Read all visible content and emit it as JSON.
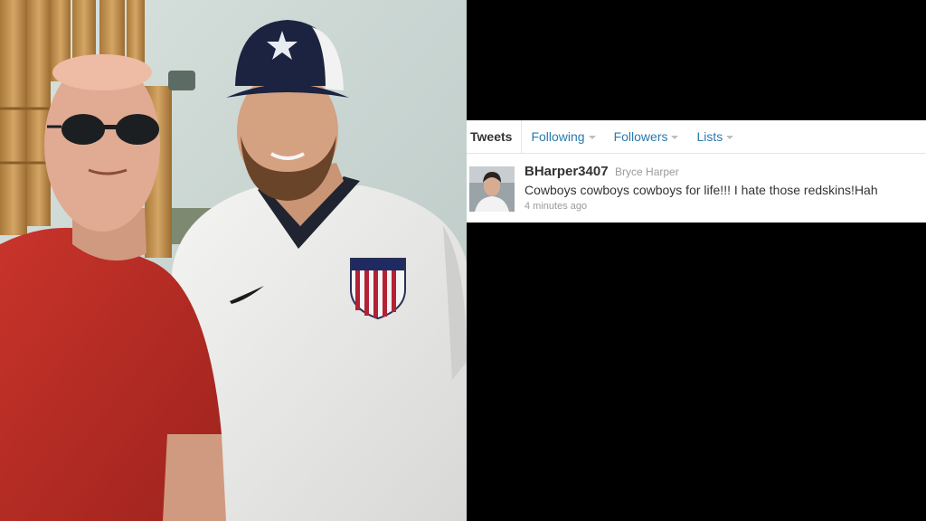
{
  "tweet_panel": {
    "tabs": [
      {
        "label": "Tweets",
        "active": true,
        "has_dropdown": false
      },
      {
        "label": "Following",
        "active": false,
        "has_dropdown": true
      },
      {
        "label": "Followers",
        "active": false,
        "has_dropdown": true
      },
      {
        "label": "Lists",
        "active": false,
        "has_dropdown": true
      }
    ],
    "tweet": {
      "screen_name": "BHarper3407",
      "full_name": "Bryce Harper",
      "text": "Cowboys cowboys cowboys for life!!! I hate those redskins!Hah",
      "timestamp": "4 minutes ago"
    }
  },
  "colors": {
    "background": "#000000",
    "card": "#ffffff",
    "link": "#2a7ab0",
    "text": "#333333",
    "muted": "#9a9a9a"
  },
  "icons": {
    "tab_dropdown": "caret-down-icon",
    "avatar": "user-avatar-photo"
  }
}
